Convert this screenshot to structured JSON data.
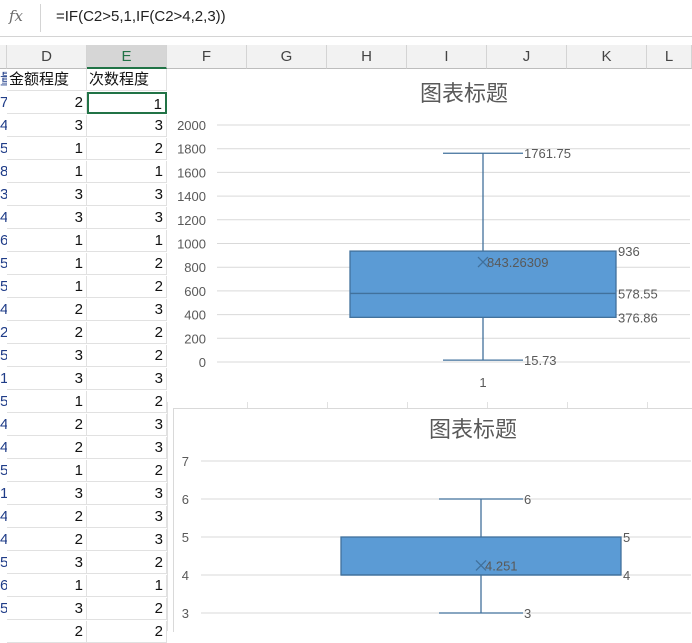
{
  "formula_bar": {
    "fx_label": "fx",
    "formula": "=IF(C2>5,1,IF(C2>4,2,3))"
  },
  "columns": [
    "D",
    "E",
    "F",
    "G",
    "H",
    "I",
    "J",
    "K",
    "L"
  ],
  "row_headers": {
    "d1": "金额程度",
    "e1": "次数程度"
  },
  "rows": [
    {
      "c": "7",
      "d": "2",
      "e": "1"
    },
    {
      "c": "4",
      "d": "3",
      "e": "3"
    },
    {
      "c": "5",
      "d": "1",
      "e": "2"
    },
    {
      "c": "8",
      "d": "1",
      "e": "1"
    },
    {
      "c": "3",
      "d": "3",
      "e": "3"
    },
    {
      "c": "4",
      "d": "3",
      "e": "3"
    },
    {
      "c": "6",
      "d": "1",
      "e": "1"
    },
    {
      "c": "5",
      "d": "1",
      "e": "2"
    },
    {
      "c": "5",
      "d": "1",
      "e": "2"
    },
    {
      "c": "4",
      "d": "2",
      "e": "3"
    },
    {
      "c": "2",
      "d": "2",
      "e": "2"
    },
    {
      "c": "5",
      "d": "3",
      "e": "2"
    },
    {
      "c": "1",
      "d": "3",
      "e": "3"
    },
    {
      "c": "5",
      "d": "1",
      "e": "2"
    },
    {
      "c": "4",
      "d": "2",
      "e": "3"
    },
    {
      "c": "4",
      "d": "2",
      "e": "3"
    },
    {
      "c": "5",
      "d": "1",
      "e": "2"
    },
    {
      "c": "1",
      "d": "3",
      "e": "3"
    },
    {
      "c": "4",
      "d": "2",
      "e": "3"
    },
    {
      "c": "4",
      "d": "2",
      "e": "3"
    },
    {
      "c": "5",
      "d": "3",
      "e": "2"
    },
    {
      "c": "6",
      "d": "1",
      "e": "1"
    },
    {
      "c": "5",
      "d": "3",
      "e": "2"
    },
    {
      "c": "",
      "d": "2",
      "e": "2"
    }
  ],
  "colors": {
    "box_fill": "#5b9bd5",
    "box_stroke": "#41719c",
    "accent_green": "#217346"
  },
  "chart_data": [
    {
      "type": "boxplot",
      "title": "图表标题",
      "ylim": [
        0,
        2000
      ],
      "yticks": [
        0,
        200,
        400,
        600,
        800,
        1000,
        1200,
        1400,
        1600,
        1800,
        2000
      ],
      "categories": [
        "1"
      ],
      "min": 15.73,
      "q1": 376.86,
      "median": 578.55,
      "mean": 843.26309,
      "q3": 936,
      "max": 1761.75,
      "labels": {
        "max": "1761.75",
        "q3": "936",
        "mean": "843.26309",
        "median": "578.55",
        "q1": "376.86",
        "min": "15.73"
      },
      "grid": true
    },
    {
      "type": "boxplot",
      "title": "图表标题",
      "ylim": [
        2,
        7
      ],
      "yticks": [
        3,
        4,
        5,
        6,
        7
      ],
      "min": 3,
      "q1": 4,
      "median": 4,
      "mean": 4.251,
      "q3": 5,
      "max": 6,
      "labels": {
        "max": "6",
        "q3": "5",
        "mean": "4.251",
        "q1": "4",
        "min": "3"
      },
      "grid": true
    }
  ]
}
